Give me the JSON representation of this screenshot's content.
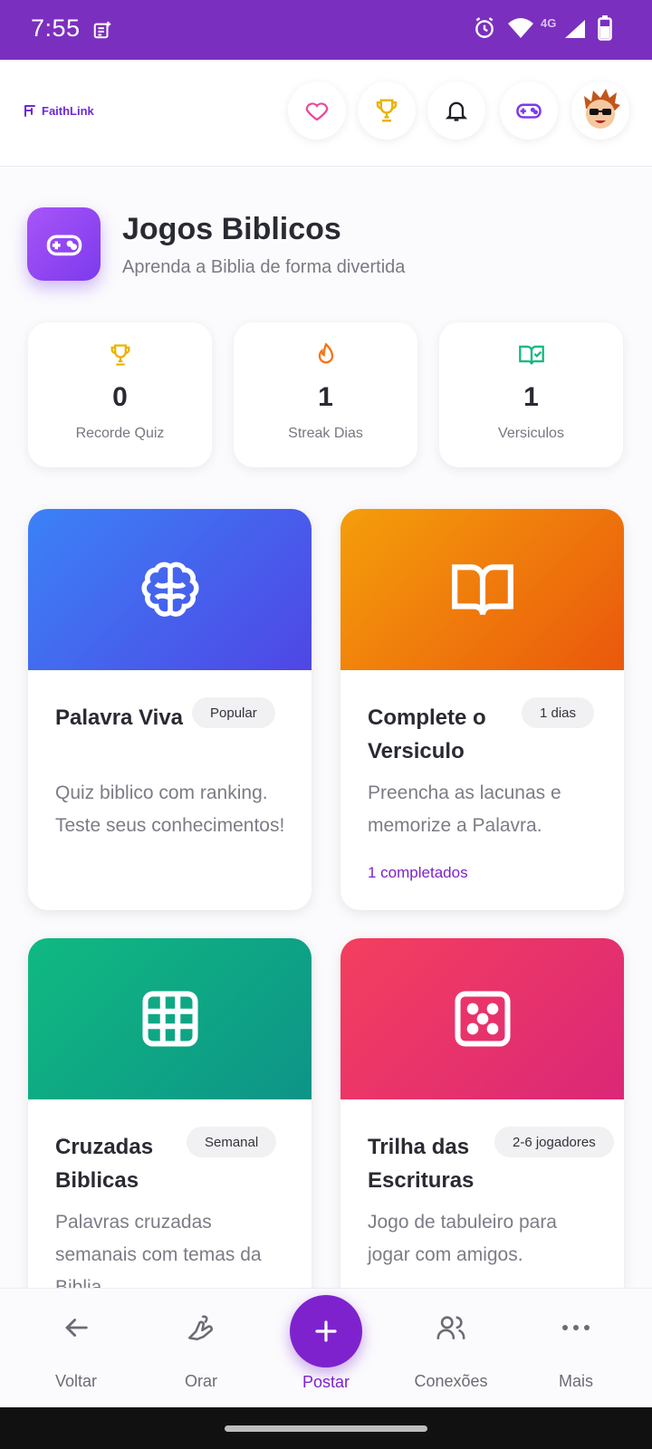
{
  "status_bar": {
    "time": "7:55",
    "network": "4G"
  },
  "header": {
    "brand": "FaithLink",
    "buttons": [
      "heart-icon",
      "trophy-icon",
      "bell-icon",
      "gamepad-icon",
      "avatar"
    ]
  },
  "page": {
    "title": "Jogos Biblicos",
    "subtitle": "Aprenda a Biblia de forma divertida"
  },
  "stats": [
    {
      "icon": "trophy-icon",
      "value": "0",
      "label": "Recorde Quiz",
      "color": "#eab308"
    },
    {
      "icon": "flame-icon",
      "value": "1",
      "label": "Streak Dias",
      "color": "#f97316"
    },
    {
      "icon": "book-check-icon",
      "value": "1",
      "label": "Versiculos",
      "color": "#10b981"
    }
  ],
  "games": [
    {
      "title": "Palavra Viva",
      "badge": "Popular",
      "desc": "Quiz biblico com ranking. Teste seus conhecimentos!",
      "extra": "",
      "icon": "brain-icon",
      "gradient": [
        "#3b82f6",
        "#4f46e5"
      ]
    },
    {
      "title": "Complete o Versiculo",
      "badge": "1 dias",
      "desc": "Preencha as lacunas e memorize a Palavra.",
      "extra": "1 completados",
      "icon": "open-book-icon",
      "gradient": [
        "#f59e0b",
        "#ea580c"
      ]
    },
    {
      "title": "Cruzadas Biblicas",
      "badge": "Semanal",
      "desc": "Palavras cruzadas semanais com temas da Biblia.",
      "extra": "",
      "icon": "grid-icon",
      "gradient": [
        "#10b981",
        "#0d9488"
      ]
    },
    {
      "title": "Trilha das Escrituras",
      "badge": "2-6 jogadores",
      "desc": "Jogo de tabuleiro para jogar com amigos.",
      "extra": "",
      "icon": "dice-icon",
      "gradient": [
        "#f43f5e",
        "#db2777"
      ]
    }
  ],
  "nav": {
    "back": "Voltar",
    "pray": "Orar",
    "post": "Postar",
    "connections": "Conexões",
    "more": "Mais"
  }
}
